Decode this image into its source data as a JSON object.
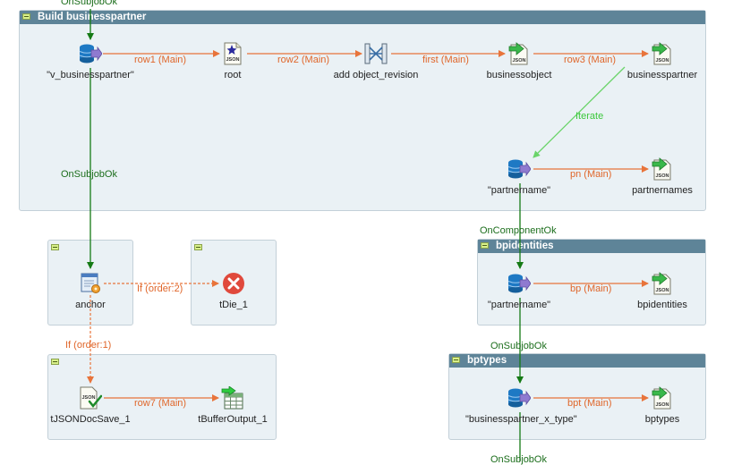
{
  "colors": {
    "main_link": "#e8743b",
    "subjob_link": "#157a15",
    "iterate_link": "#6ad46a",
    "header": "#5e8498",
    "subjob_bg": "#eaf1f5"
  },
  "subjobs": {
    "build": "Build businesspartner",
    "bpidentities": "bpidentities",
    "bptypes": "bptypes"
  },
  "nodes": {
    "v_businesspartner": {
      "label": "\"v_businesspartner\"",
      "icon": "database-input-icon"
    },
    "root": {
      "label": "root",
      "icon": "json-star-icon"
    },
    "add_object_revision": {
      "label": "add object_revision",
      "icon": "map-icon"
    },
    "businessobject": {
      "label": "businessobject",
      "icon": "json-output-icon"
    },
    "businesspartner": {
      "label": "businesspartner",
      "icon": "json-output-icon"
    },
    "partnername1": {
      "label": "\"partnername\"",
      "icon": "database-input-icon"
    },
    "partnernames": {
      "label": "partnernames",
      "icon": "json-output-icon"
    },
    "anchor": {
      "label": "anchor",
      "icon": "anchor-icon"
    },
    "tdie": {
      "label": "tDie_1",
      "icon": "error-icon"
    },
    "partnername2": {
      "label": "\"partnername\"",
      "icon": "database-input-icon"
    },
    "bpidentities": {
      "label": "bpidentities",
      "icon": "json-output-icon"
    },
    "tjsondocsave": {
      "label": "tJSONDocSave_1",
      "icon": "json-save-icon"
    },
    "tbufferoutput": {
      "label": "tBufferOutput_1",
      "icon": "buffer-output-icon"
    },
    "bpx_type": {
      "label": "\"businesspartner_x_type\"",
      "icon": "database-input-icon"
    },
    "bptypes": {
      "label": "bptypes",
      "icon": "json-output-icon"
    }
  },
  "links": {
    "top_onsubjob": "OnSubjobOk",
    "row1": "row1 (Main)",
    "row2": "row2 (Main)",
    "first": "first (Main)",
    "row3": "row3 (Main)",
    "iterate": "Iterate",
    "pn": "pn (Main)",
    "onsubjob_mid": "OnSubjobOk",
    "oncomponent": "OnComponentOk",
    "if2": "If (order:2)",
    "bp": "bp (Main)",
    "if1": "If (order:1)",
    "onsubjob_bptypes": "OnSubjobOk",
    "row7": "row7 (Main)",
    "bpt": "bpt (Main)",
    "bottom_onsubjob": "OnSubjobOk"
  }
}
